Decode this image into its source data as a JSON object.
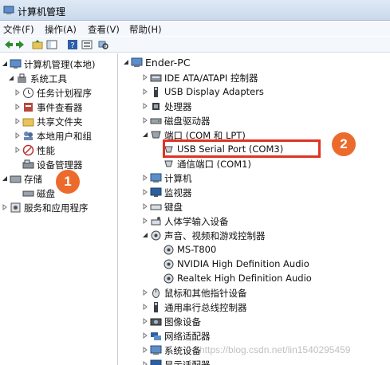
{
  "window": {
    "title": "计算机管理"
  },
  "menu": [
    "文件(F)",
    "操作(A)",
    "查看(V)",
    "帮助(H)"
  ],
  "left_tree": [
    {
      "label": "计算机管理(本地)",
      "icon": "computer-manage-icon"
    },
    {
      "label": "系统工具",
      "icon": "tools-icon"
    },
    {
      "label": "任务计划程序",
      "icon": "clock-icon"
    },
    {
      "label": "事件查看器",
      "icon": "event-viewer-icon"
    },
    {
      "label": "共享文件夹",
      "icon": "shared-folder-icon"
    },
    {
      "label": "本地用户和组",
      "icon": "users-icon"
    },
    {
      "label": "性能",
      "icon": "performance-icon"
    },
    {
      "label": "设备管理器",
      "icon": "device-manager-icon"
    },
    {
      "label": "存储",
      "icon": "storage-icon"
    },
    {
      "label": "磁盘",
      "icon": "disk-icon"
    },
    {
      "label": "服务和应用程序",
      "icon": "services-icon"
    }
  ],
  "device_tree": [
    {
      "label": "Ender-PC",
      "icon": "computer-icon"
    },
    {
      "label": "IDE ATA/ATAPI 控制器",
      "icon": "ide-icon"
    },
    {
      "label": "USB Display Adapters",
      "icon": "usb-icon"
    },
    {
      "label": "处理器",
      "icon": "cpu-icon"
    },
    {
      "label": "磁盘驱动器",
      "icon": "disk-drive-icon"
    },
    {
      "label": "端口 (COM 和 LPT)",
      "icon": "port-icon"
    },
    {
      "label": "USB Serial Port (COM3)",
      "icon": "serial-port-icon"
    },
    {
      "label": "通信端口 (COM1)",
      "icon": "com-port-icon"
    },
    {
      "label": "计算机",
      "icon": "computer-icon"
    },
    {
      "label": "监视器",
      "icon": "monitor-icon"
    },
    {
      "label": "键盘",
      "icon": "keyboard-icon"
    },
    {
      "label": "人体学输入设备",
      "icon": "hid-icon"
    },
    {
      "label": "声音、视频和游戏控制器",
      "icon": "sound-icon"
    },
    {
      "label": "MS-T800",
      "icon": "sound-device-icon"
    },
    {
      "label": "NVIDIA High Definition Audio",
      "icon": "sound-device-icon"
    },
    {
      "label": "Realtek High Definition Audio",
      "icon": "sound-device-icon"
    },
    {
      "label": "鼠标和其他指针设备",
      "icon": "mouse-icon"
    },
    {
      "label": "通用串行总线控制器",
      "icon": "usb-controller-icon"
    },
    {
      "label": "图像设备",
      "icon": "camera-icon"
    },
    {
      "label": "网络适配器",
      "icon": "network-icon"
    },
    {
      "label": "系统设备",
      "icon": "system-device-icon"
    },
    {
      "label": "显示适配器",
      "icon": "display-adapter-icon"
    }
  ],
  "annotations": {
    "badge_1": "1",
    "badge_2": "2"
  },
  "watermark": "https://blog.csdn.net/lin1540295459",
  "colors": {
    "badge": "#ec6a2b",
    "highlight": "#e03222"
  }
}
